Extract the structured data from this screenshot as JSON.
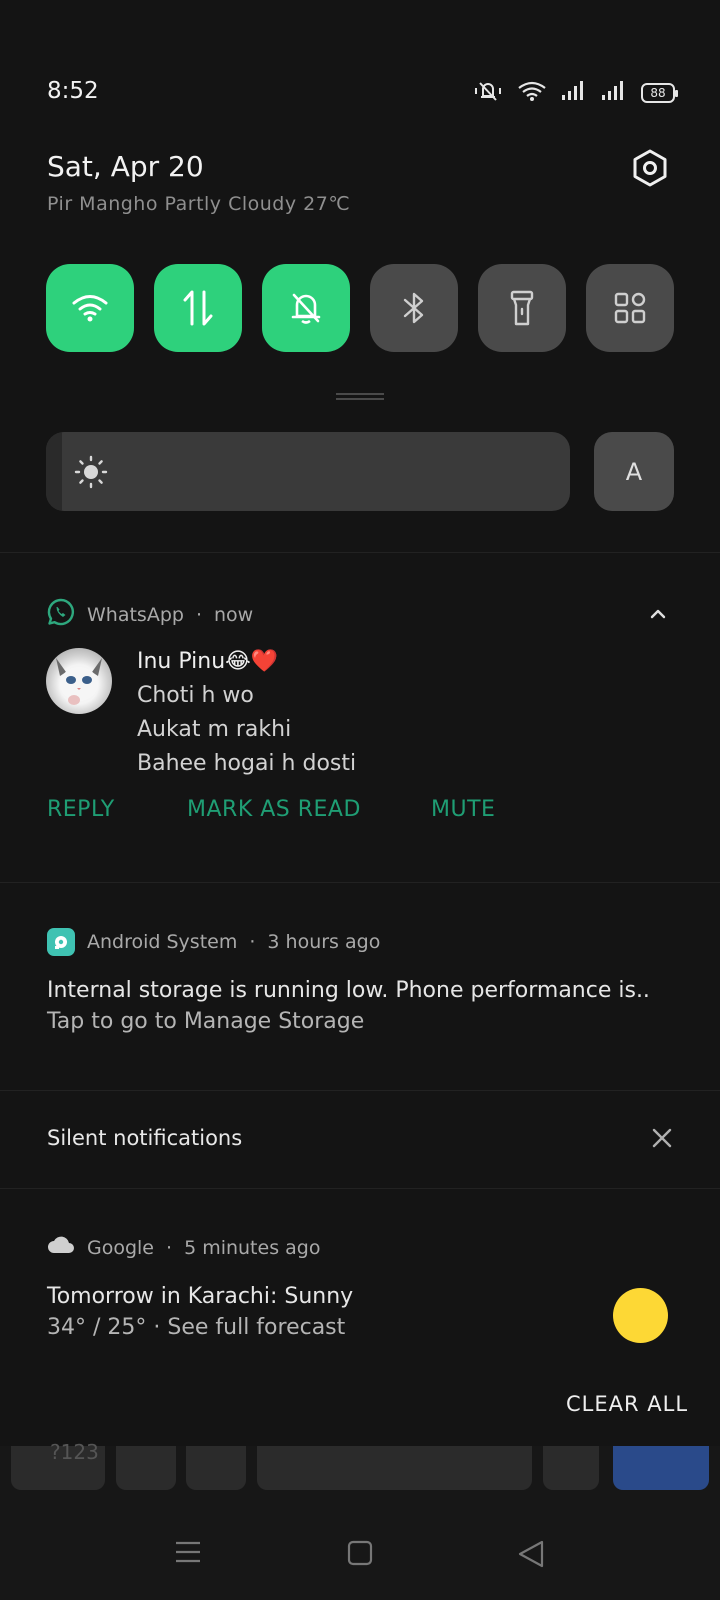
{
  "status_bar": {
    "time": "8:52",
    "battery": "88"
  },
  "header": {
    "date": "Sat, Apr 20",
    "weather": "Pir Mangho Partly Cloudy 27℃"
  },
  "quick_tiles": [
    {
      "name": "wifi",
      "state": "on"
    },
    {
      "name": "mobile-data",
      "state": "on"
    },
    {
      "name": "silent",
      "state": "on"
    },
    {
      "name": "bluetooth",
      "state": "off"
    },
    {
      "name": "flashlight",
      "state": "off"
    },
    {
      "name": "more-tiles",
      "state": "off"
    }
  ],
  "brightness": {
    "level": 0.03,
    "auto_label": "A"
  },
  "notifications": {
    "whatsapp": {
      "app": "WhatsApp",
      "time": "now",
      "sender": "Inu Pinu😂❤️",
      "messages": [
        "Choti h wo",
        "Aukat m rakhi",
        "Bahee hogai h dosti"
      ],
      "actions": [
        "REPLY",
        "MARK AS READ",
        "MUTE"
      ]
    },
    "android_system": {
      "app": "Android System",
      "time": "3 hours ago",
      "title": "Internal storage is running low. Phone performance is..",
      "text": "Tap to go to Manage Storage"
    },
    "silent_header": "Silent notifications",
    "google": {
      "app": "Google",
      "time": "5 minutes ago",
      "title": "Tomorrow in Karachi: Sunny",
      "text": "34° / 25° · See full forecast"
    },
    "clear_all": "CLEAR ALL"
  },
  "keyboard": {
    "label": "?123"
  },
  "colors": {
    "accent_green": "#2ed17c",
    "action_teal": "#1f9e74",
    "sun_yellow": "#fdd835"
  }
}
